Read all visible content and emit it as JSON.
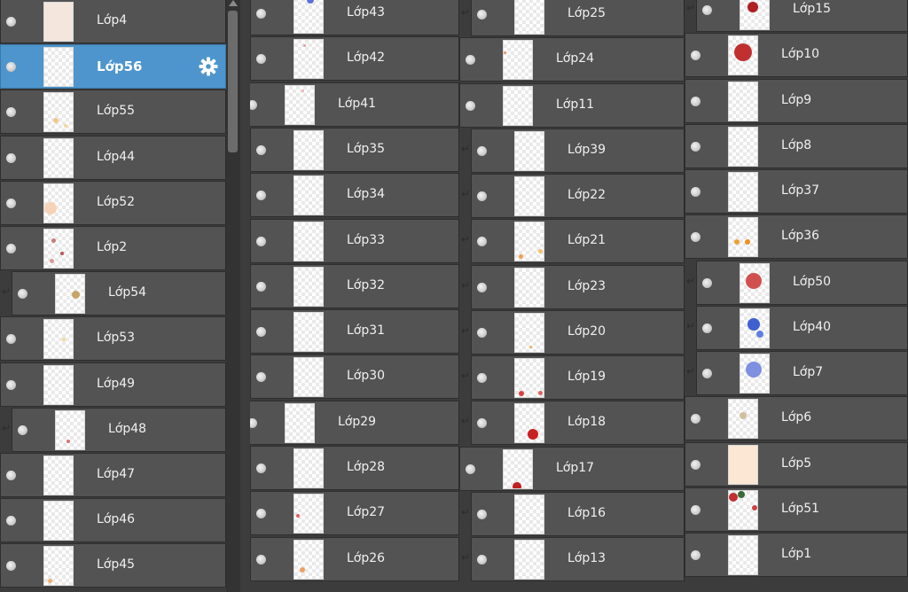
{
  "scrollbar": {
    "up_arrow": "triangle-up-icon"
  },
  "columns": [
    [
      {
        "label": "Lớp4",
        "mark": "blank"
      },
      {
        "label": "Lớp56",
        "mark": "blank",
        "selected": true,
        "gear": "gear-icon"
      },
      {
        "label": "Lớp55",
        "mark": "blank"
      },
      {
        "label": "Lớp44",
        "mark": "blank"
      },
      {
        "label": "Lớp52",
        "mark": "blank"
      },
      {
        "label": "Lớp2",
        "mark": "blank"
      },
      {
        "label": "Lớp54",
        "mark": "clipped"
      },
      {
        "label": "Lớp53",
        "mark": "blank"
      },
      {
        "label": "Lớp49",
        "mark": "blank"
      },
      {
        "label": "Lớp48",
        "mark": "clipped"
      },
      {
        "label": "Lớp47",
        "mark": "blank"
      },
      {
        "label": "Lớp46",
        "mark": "blank"
      },
      {
        "label": "Lớp45",
        "mark": "blank"
      }
    ],
    [
      {
        "label": "Lớp43",
        "mark": "clipped"
      },
      {
        "label": "Lớp42",
        "mark": "clipped"
      },
      {
        "label": "Lớp41",
        "mark": "blank"
      },
      {
        "label": "Lớp35",
        "mark": "clipped"
      },
      {
        "label": "Lớp34",
        "mark": "clipped"
      },
      {
        "label": "Lớp33",
        "mark": "clipped"
      },
      {
        "label": "Lớp32",
        "mark": "clipped"
      },
      {
        "label": "Lớp31",
        "mark": "clipped"
      },
      {
        "label": "Lớp30",
        "mark": "clipped"
      },
      {
        "label": "Lớp29",
        "mark": "blank"
      },
      {
        "label": "Lớp28",
        "mark": "clipped"
      },
      {
        "label": "Lớp27",
        "mark": "clipped"
      },
      {
        "label": "Lớp26",
        "mark": "clipped"
      }
    ],
    [
      {
        "label": "Lớp25",
        "mark": "clipped"
      },
      {
        "label": "Lớp24",
        "mark": "blank"
      },
      {
        "label": "Lớp11",
        "mark": "blank"
      },
      {
        "label": "Lớp39",
        "mark": "clipped"
      },
      {
        "label": "Lớp22",
        "mark": "clipped"
      },
      {
        "label": "Lớp21",
        "mark": "clipped"
      },
      {
        "label": "Lớp23",
        "mark": "clipped"
      },
      {
        "label": "Lớp20",
        "mark": "clipped"
      },
      {
        "label": "Lớp19",
        "mark": "clipped"
      },
      {
        "label": "Lớp18",
        "mark": "clipped"
      },
      {
        "label": "Lớp17",
        "mark": "blank"
      },
      {
        "label": "Lớp16",
        "mark": "clipped"
      },
      {
        "label": "Lớp13",
        "mark": "clipped"
      }
    ],
    [
      {
        "label": "Lớp15",
        "mark": "clipped"
      },
      {
        "label": "Lớp10",
        "mark": "blank"
      },
      {
        "label": "Lớp9",
        "mark": "blank"
      },
      {
        "label": "Lớp8",
        "mark": "blank"
      },
      {
        "label": "Lớp37",
        "mark": "blank"
      },
      {
        "label": "Lớp36",
        "mark": "blank"
      },
      {
        "label": "Lớp50",
        "mark": "clipped"
      },
      {
        "label": "Lớp40",
        "mark": "clipped"
      },
      {
        "label": "Lớp7",
        "mark": "clipped"
      },
      {
        "label": "Lớp6",
        "mark": "blank"
      },
      {
        "label": "Lớp5",
        "mark": "blank"
      },
      {
        "label": "Lớp51",
        "mark": "blank"
      },
      {
        "label": "Lớp1",
        "mark": "blank"
      }
    ]
  ]
}
